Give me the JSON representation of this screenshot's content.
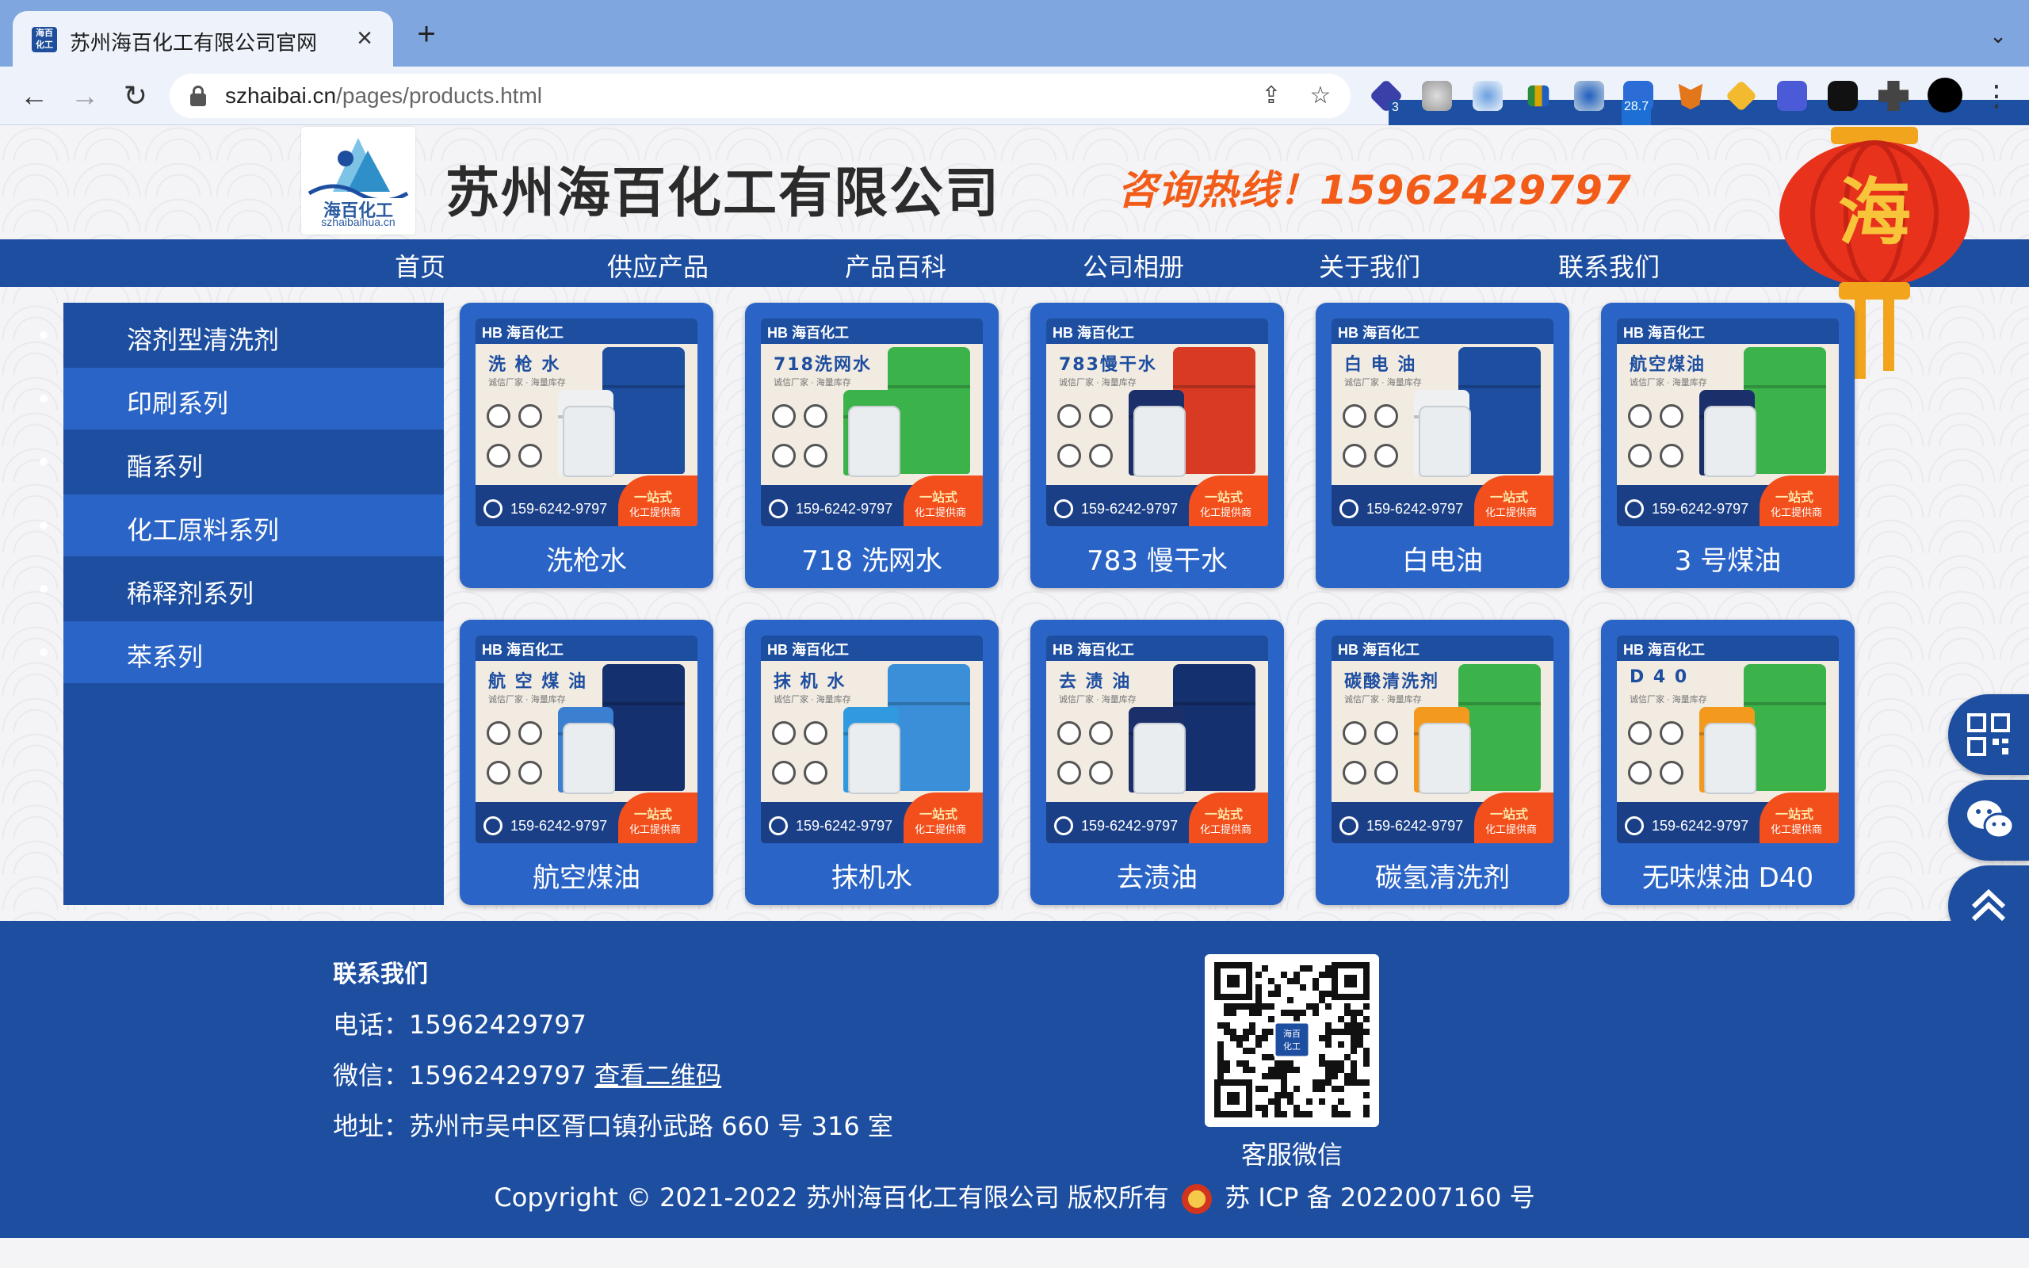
{
  "browser": {
    "tab_title": "苏州海百化工有限公司官网",
    "favicon_text": "海百化工",
    "url_host": "szhaibai.cn",
    "url_path": "/pages/products.html",
    "extensions": [
      {
        "name": "ext-1",
        "badge": "3"
      },
      {
        "name": "ext-weather",
        "badge": "28.7"
      }
    ]
  },
  "header": {
    "logo_name": "海百化工",
    "logo_url": "szhaibaihua.cn",
    "company_name": "苏州海百化工有限公司",
    "hotline": "咨询热线！15962429797",
    "lantern_char": "海"
  },
  "nav": {
    "items": [
      "首页",
      "供应产品",
      "产品百科",
      "公司相册",
      "关于我们",
      "联系我们"
    ]
  },
  "sidebar": {
    "items": [
      "溶剂型清洗剂",
      "印刷系列",
      "酯系列",
      "化工原料系列",
      "稀释剂系列",
      "苯系列"
    ]
  },
  "product_image": {
    "brand": "HB 海百化工",
    "sub": "诚信厂家 · 海量库存",
    "phone": "159-6242-9797",
    "badge_title": "一站式",
    "badge_sub": "化工提供商"
  },
  "products": [
    {
      "label": "洗枪水",
      "img_title": "洗 枪 水"
    },
    {
      "label": "718 洗网水",
      "img_title": "718洗网水"
    },
    {
      "label": "783 慢干水",
      "img_title": "783慢干水"
    },
    {
      "label": "白电油",
      "img_title": "白 电 油"
    },
    {
      "label": "3 号煤油",
      "img_title": "航空煤油"
    },
    {
      "label": "航空煤油",
      "img_title": "航 空 煤 油"
    },
    {
      "label": "抹机水",
      "img_title": "抹 机 水"
    },
    {
      "label": "去渍油",
      "img_title": "去 渍 油"
    },
    {
      "label": "碳氢清洗剂",
      "img_title": "碳酸清洗剂"
    },
    {
      "label": "无味煤油 D40",
      "img_title": "D 4 0"
    }
  ],
  "footer": {
    "title": "联系我们",
    "phone_line": "电话：15962429797",
    "wechat_prefix": "微信：15962429797 ",
    "wechat_link": "查看二维码",
    "address_line": "地址：苏州市吴中区胥口镇孙武路 660 号 316 室",
    "qr_caption": "客服微信",
    "qr_center": "海百化工",
    "copyright_a": "Copyright © 2021-2022 苏州海百化工有限公司 版权所有",
    "copyright_b": "苏 ICP 备 2022007160 号"
  },
  "colors": {
    "primary": "#1d4ea0",
    "secondary": "#2a64c6",
    "hotline": "#f25c18"
  }
}
